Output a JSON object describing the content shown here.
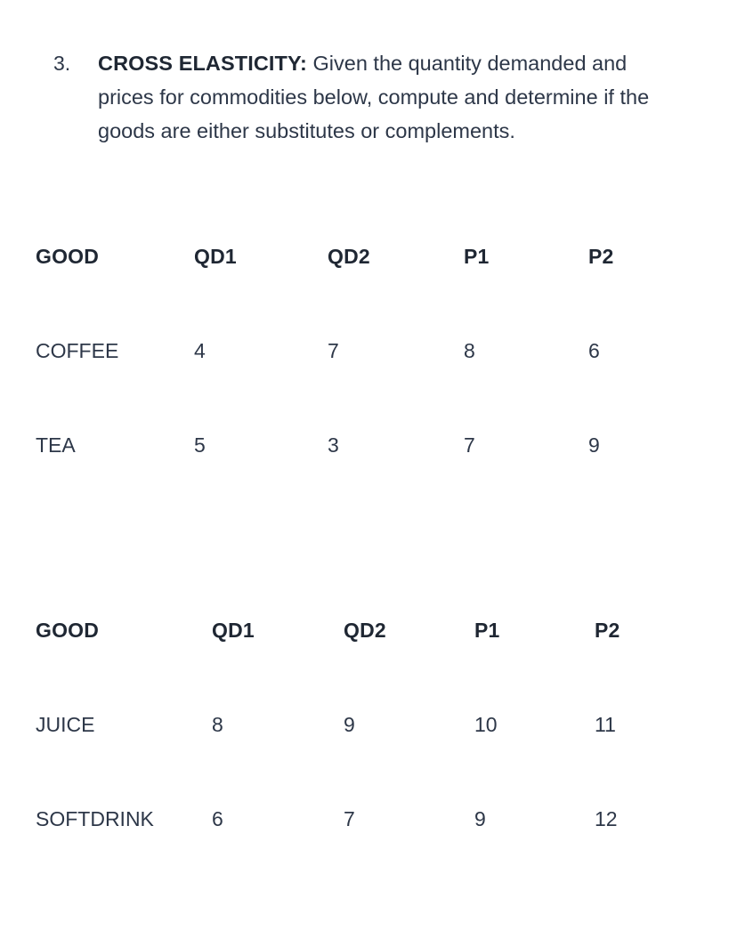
{
  "question": {
    "number": "3.",
    "label": "CROSS ELASTICITY:",
    "text": " Given the quantity demanded and prices for commodities below, compute and determine if the goods are either substitutes or complements."
  },
  "tables": [
    {
      "id": "table-1",
      "headers": [
        "GOOD",
        "QD1",
        "QD2",
        "P1",
        "P2"
      ],
      "rows": [
        [
          "COFFEE",
          "4",
          "7",
          "8",
          "6"
        ],
        [
          "TEA",
          "5",
          "3",
          "7",
          "9"
        ]
      ]
    },
    {
      "id": "table-2",
      "headers": [
        "GOOD",
        "QD1",
        "QD2",
        "P1",
        "P2"
      ],
      "rows": [
        [
          "JUICE",
          "8",
          "9",
          "10",
          "11"
        ],
        [
          "SOFTDRINK",
          "6",
          "7",
          "9",
          "12"
        ]
      ]
    }
  ],
  "colors": {
    "background": "#ffffff",
    "text": "#2d3748",
    "heading": "#1f2733"
  }
}
